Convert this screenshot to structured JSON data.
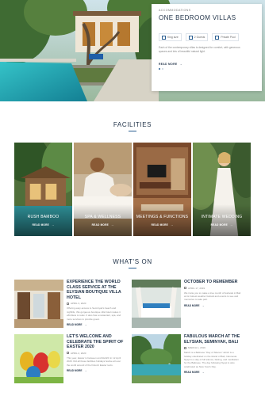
{
  "hero": {
    "card": {
      "eyebrow": "ACCOMMODATIONS",
      "title": "ONE BEDROOM VILLAS",
      "specs": [
        {
          "icon": "bed-icon",
          "label": "King size"
        },
        {
          "icon": "guests-icon",
          "label": "2 Guests"
        },
        {
          "icon": "pool-icon",
          "label": "Private Pool"
        }
      ],
      "description": "Each of the contemporary villas is designed for comfort, with generous spaces and lots of beautiful natural light.",
      "read_more": "READ MORE",
      "slides": 2,
      "active_slide": 1
    }
  },
  "facilities": {
    "title": "FACILITIES",
    "items": [
      {
        "label": "RUSH BAMBOO",
        "more": "READ MORE"
      },
      {
        "label": "SPA & WELLNESS",
        "more": "READ MORE"
      },
      {
        "label": "MEETINGS & FUNCTIONS",
        "more": "READ MORE"
      },
      {
        "label": "INTIMATE WEDDING",
        "more": "READ MORE"
      }
    ]
  },
  "whats_on": {
    "title": "WHAT'S ON",
    "events": [
      {
        "title": "EXPERIENCE THE WORLD CLASS SERVICE AT THE ELYSIAN BOUTIQUE VILLA HOTEL",
        "date": "APRIL 3, 2020",
        "description": "Offering easy access to Seminyak's beach and nightlife, this gorgeous boutique villa hotel makes it effortless to relax. It also has a restaurant, spa, and more services to provide guest.",
        "more": "READ MORE"
      },
      {
        "title": "OCTOBER TO REMEMBER",
        "date": "APRIL 17, 2019",
        "description": "We invite you to make a true month of festivals in Bali at its hottest weather festival and events to see and memories to take part.",
        "more": "READ MORE"
      },
      {
        "title": "LET'S WELCOME AND CELEBRATE THE SPIRIT OF EASTER 2020",
        "date": "APRIL 2, 2020",
        "description": "This year, Easter is between and Rebirth in 12 April 2020. Did all these facilities holidays festive all over the world around of the historic Easter texts.",
        "more": "READ MORE"
      },
      {
        "title": "FABULOUS MARCH AT THE ELYSIAN, SEMINYAK, BALI",
        "date": "MARCH 1, 2019",
        "description": "March is a Balinese \"Day of Silence\" which is a holiday celebrated on the island of Bali, Indonesia. Nyepi is a day of full silence, fasting, and meditation for the Balinese. The day following Nyepi is also celebrated as New Year's Day.",
        "more": "READ MORE"
      }
    ]
  },
  "colors": {
    "navy": "#1f3147",
    "accent_blue": "#2b5f92",
    "muted_text": "#888888"
  }
}
